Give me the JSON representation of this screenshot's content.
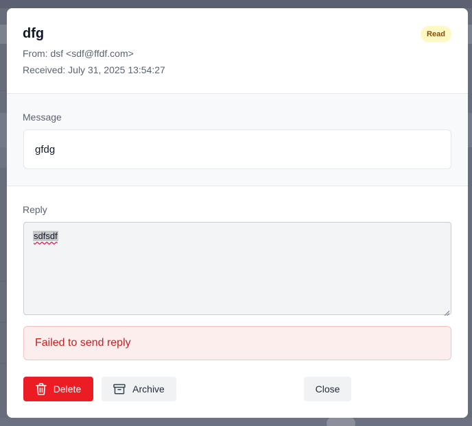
{
  "email": {
    "subject": "dfg",
    "status": "Read",
    "from_label": "From:",
    "from_value": "dsf <sdf@ffdf.com>",
    "received_label": "Received:",
    "received_value": "July 31, 2025 13:54:27"
  },
  "message": {
    "label": "Message",
    "body": "gfdg"
  },
  "reply": {
    "label": "Reply",
    "value": "sdfsdf"
  },
  "error": {
    "text": "Failed to send reply"
  },
  "actions": {
    "delete_label": "Delete",
    "archive_label": "Archive",
    "close_label": "Close"
  },
  "icons": {
    "delete": "trash-icon",
    "archive": "archive-icon"
  },
  "colors": {
    "danger": "#ec1c24",
    "badge_bg": "#fef9c3",
    "badge_text": "#854d0e",
    "error_bg": "#fdeeee",
    "error_text": "#c81e1e"
  }
}
